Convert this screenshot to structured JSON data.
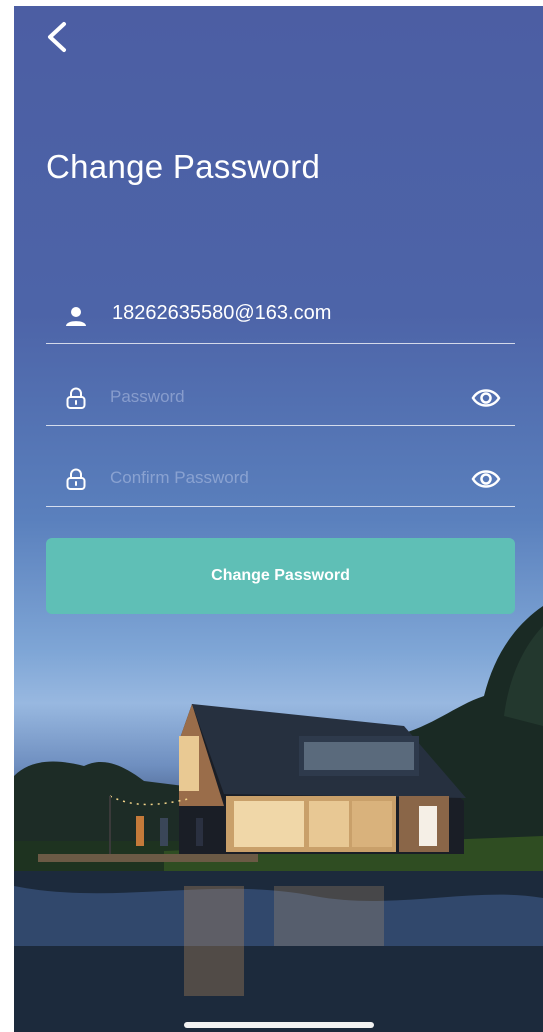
{
  "header": {
    "back_icon": "chevron-left-icon",
    "title": "Change Password"
  },
  "form": {
    "account": {
      "icon": "user-icon",
      "value": "18262635580@163.com"
    },
    "password": {
      "icon": "lock-icon",
      "placeholder": "Password",
      "toggle_icon": "eye-icon"
    },
    "confirm_password": {
      "icon": "lock-icon",
      "placeholder": "Confirm Password",
      "toggle_icon": "eye-icon"
    },
    "submit_label": "Change Password"
  },
  "colors": {
    "background_top": "#4c5ea3",
    "accent_button": "#5fbfb6",
    "text": "#ffffff"
  }
}
